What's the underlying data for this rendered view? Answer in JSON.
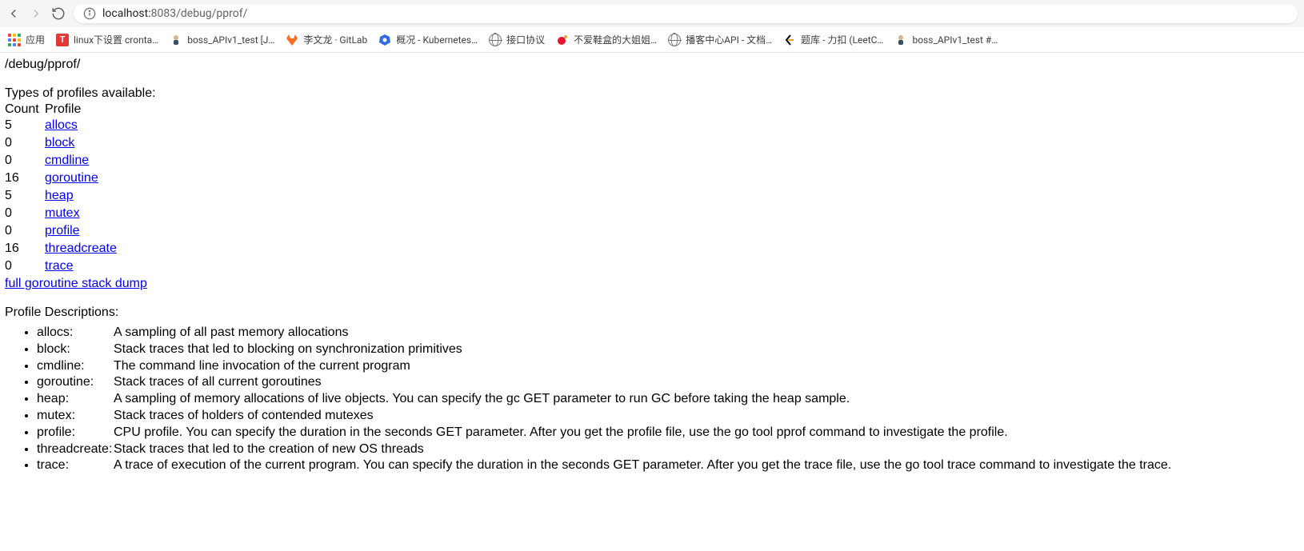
{
  "url": {
    "host": "localhost:",
    "port_path": "8083/debug/pprof/"
  },
  "bookmarks": {
    "apps": "应用",
    "items": [
      {
        "label": "linux下设置 cronta…",
        "icon": "t-icon"
      },
      {
        "label": "boss_APIv1_test [J…",
        "icon": "user-green"
      },
      {
        "label": "李文龙 · GitLab",
        "icon": "gitlab"
      },
      {
        "label": "概况 - Kubernetes…",
        "icon": "k8s"
      },
      {
        "label": "接口协议",
        "icon": "globe"
      },
      {
        "label": "不爱鞋盒的大姐姐…",
        "icon": "weibo"
      },
      {
        "label": "播客中心API - 文档…",
        "icon": "globe"
      },
      {
        "label": "题库 - 力扣 (LeetC…",
        "icon": "leetcode"
      },
      {
        "label": "boss_APIv1_test #…",
        "icon": "user-green"
      }
    ]
  },
  "page": {
    "title": "/debug/pprof/",
    "types_heading": "Types of profiles available:",
    "table_headers": {
      "count": "Count",
      "profile": "Profile"
    },
    "profiles": [
      {
        "count": "5",
        "name": "allocs"
      },
      {
        "count": "0",
        "name": "block"
      },
      {
        "count": "0",
        "name": "cmdline"
      },
      {
        "count": "16",
        "name": "goroutine"
      },
      {
        "count": "5",
        "name": "heap"
      },
      {
        "count": "0",
        "name": "mutex"
      },
      {
        "count": "0",
        "name": "profile"
      },
      {
        "count": "16",
        "name": "threadcreate"
      },
      {
        "count": "0",
        "name": "trace"
      }
    ],
    "dump_link": "full goroutine stack dump",
    "desc_heading": "Profile Descriptions:",
    "descriptions": [
      {
        "name": "allocs:",
        "text": "A sampling of all past memory allocations"
      },
      {
        "name": "block:",
        "text": "Stack traces that led to blocking on synchronization primitives"
      },
      {
        "name": "cmdline:",
        "text": "The command line invocation of the current program"
      },
      {
        "name": "goroutine:",
        "text": "Stack traces of all current goroutines"
      },
      {
        "name": "heap:",
        "text": "A sampling of memory allocations of live objects. You can specify the gc GET parameter to run GC before taking the heap sample."
      },
      {
        "name": "mutex:",
        "text": "Stack traces of holders of contended mutexes"
      },
      {
        "name": "profile:",
        "text": "CPU profile. You can specify the duration in the seconds GET parameter. After you get the profile file, use the go tool pprof command to investigate the profile."
      },
      {
        "name": "threadcreate:",
        "text": "Stack traces that led to the creation of new OS threads"
      },
      {
        "name": "trace:",
        "text": "A trace of execution of the current program. You can specify the duration in the seconds GET parameter. After you get the trace file, use the go tool trace command to investigate the trace."
      }
    ]
  }
}
